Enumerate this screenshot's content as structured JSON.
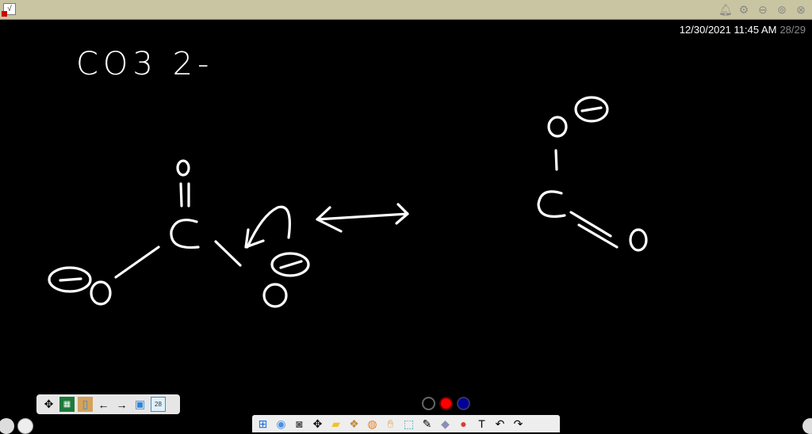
{
  "titlebar": {
    "app_icon": "whiteboard-app-icon",
    "icons": [
      "bell-icon",
      "gear-icon",
      "minimize-icon",
      "restore-icon",
      "close-icon"
    ]
  },
  "status": {
    "datetime": "12/30/2021 11:45 AM",
    "page": "28/29"
  },
  "board": {
    "formula": "CO3 2-",
    "content": "Carbonate ion resonance structures"
  },
  "toolbar1": {
    "page_number": "28",
    "icons": [
      "move-icon",
      "board-icon",
      "import-icon",
      "prev-page-icon",
      "next-page-icon",
      "add-page-icon",
      "page-number-icon"
    ]
  },
  "colors": {
    "black": "#000000",
    "red": "#ff0000",
    "blue": "#000099"
  },
  "toolbar2": {
    "icons": [
      "windows-icon",
      "people-icon",
      "screenshot-icon",
      "move-icon",
      "folder-icon",
      "box-icon",
      "browser-icon",
      "hand-icon",
      "select-icon",
      "pen-icon",
      "eraser-icon",
      "shape-icon",
      "text-icon",
      "undo-icon",
      "redo-icon"
    ]
  }
}
